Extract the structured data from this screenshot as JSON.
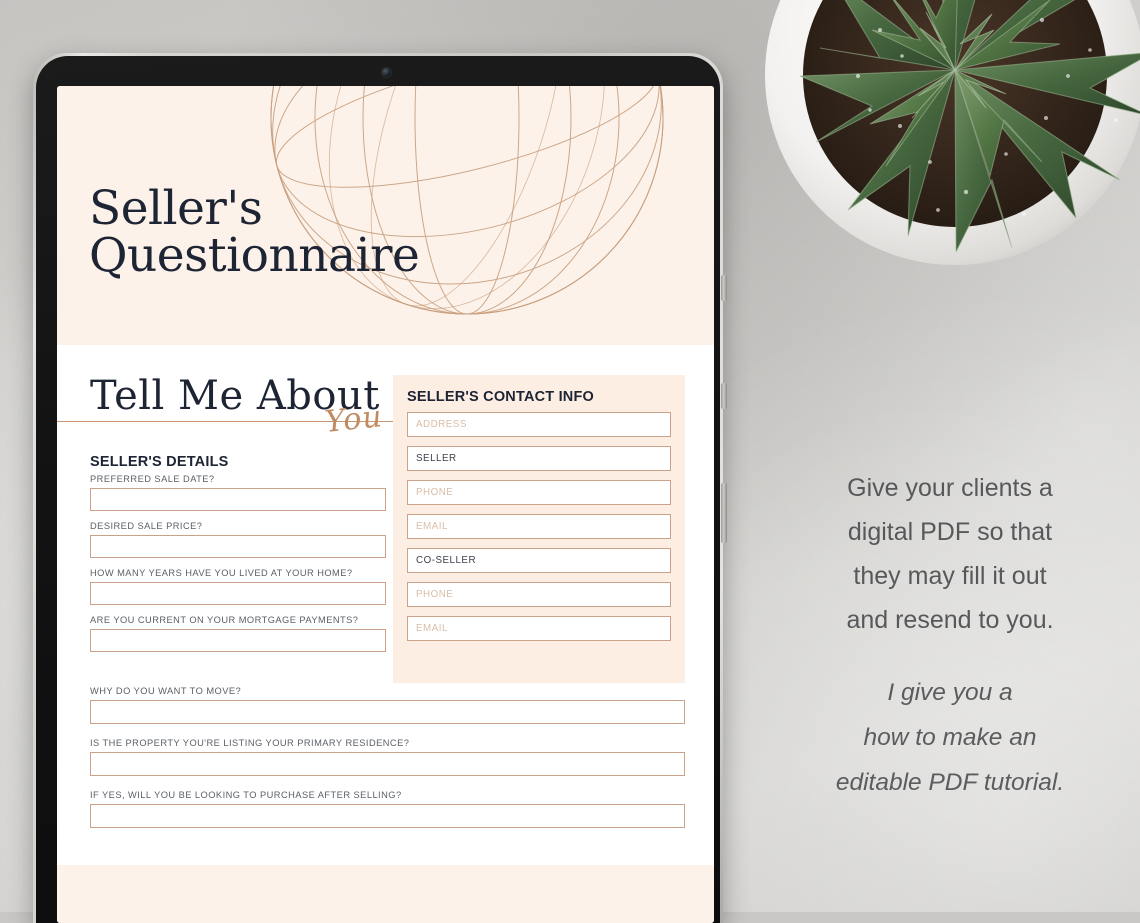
{
  "document": {
    "title_line1": "Seller's",
    "title_line2": "Questionnaire",
    "section_heading_main": "Tell Me About",
    "section_heading_script": "You"
  },
  "sellers_details": {
    "heading": "SELLER'S DETAILS",
    "questions": [
      {
        "label": "PREFERRED SALE DATE?",
        "value": ""
      },
      {
        "label": "DESIRED SALE PRICE?",
        "value": ""
      },
      {
        "label": "HOW MANY YEARS HAVE YOU LIVED AT YOUR HOME?",
        "value": ""
      },
      {
        "label": "ARE YOU CURRENT ON YOUR MORTGAGE PAYMENTS?",
        "value": ""
      }
    ]
  },
  "wide_questions": [
    {
      "label": "WHY DO YOU WANT TO MOVE?",
      "value": ""
    },
    {
      "label": "IS THE PROPERTY YOU'RE LISTING YOUR PRIMARY RESIDENCE?",
      "value": ""
    },
    {
      "label": "IF YES, WILL YOU BE LOOKING TO PURCHASE AFTER SELLING?",
      "value": ""
    }
  ],
  "contact_info": {
    "heading": "SELLER'S CONTACT INFO",
    "fields": [
      {
        "name": "address",
        "text": "ADDRESS",
        "kind": "placeholder"
      },
      {
        "name": "seller",
        "text": "SELLER",
        "kind": "label"
      },
      {
        "name": "seller-phone",
        "text": "PHONE",
        "kind": "placeholder"
      },
      {
        "name": "seller-email",
        "text": "EMAIL",
        "kind": "placeholder"
      },
      {
        "name": "co-seller",
        "text": "CO-SELLER",
        "kind": "label"
      },
      {
        "name": "co-seller-phone",
        "text": "PHONE",
        "kind": "placeholder"
      },
      {
        "name": "co-seller-email",
        "text": "EMAIL",
        "kind": "placeholder"
      }
    ]
  },
  "marketing_copy": {
    "block1": [
      "Give your clients a",
      "digital PDF so that",
      "they may fill it out",
      "and resend to you."
    ],
    "block2": [
      "I give you a",
      "how to make an",
      "editable PDF tutorial."
    ]
  },
  "colors": {
    "cream_header": "#FDF2EA",
    "cream_panel": "#FDEEE4",
    "field_border": "#C9A289",
    "title_navy": "#1D2433",
    "script_copper": "#C08B63",
    "label_gray": "#5B6067",
    "copy_gray": "#57585A"
  }
}
